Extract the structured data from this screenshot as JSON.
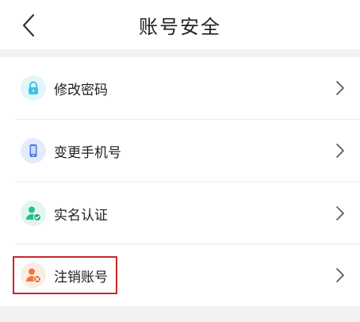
{
  "header": {
    "title": "账号安全",
    "back_icon": "chevron-left-icon"
  },
  "items": [
    {
      "label": "修改密码",
      "icon": "lock-icon",
      "icon_color": "#3fc2e6",
      "icon_bg": "#e3f6fb"
    },
    {
      "label": "变更手机号",
      "icon": "phone-icon",
      "icon_color": "#4a78e0",
      "icon_bg": "#e4ebfb"
    },
    {
      "label": "实名认证",
      "icon": "user-verified-icon",
      "icon_color": "#27c08a",
      "icon_bg": "#e1f6ee"
    },
    {
      "label": "注销账号",
      "icon": "user-remove-icon",
      "icon_color": "#f07a3c",
      "icon_bg": "#fdece3"
    }
  ],
  "chevron_icon": "chevron-right-icon",
  "highlight_color": "#c7272b"
}
